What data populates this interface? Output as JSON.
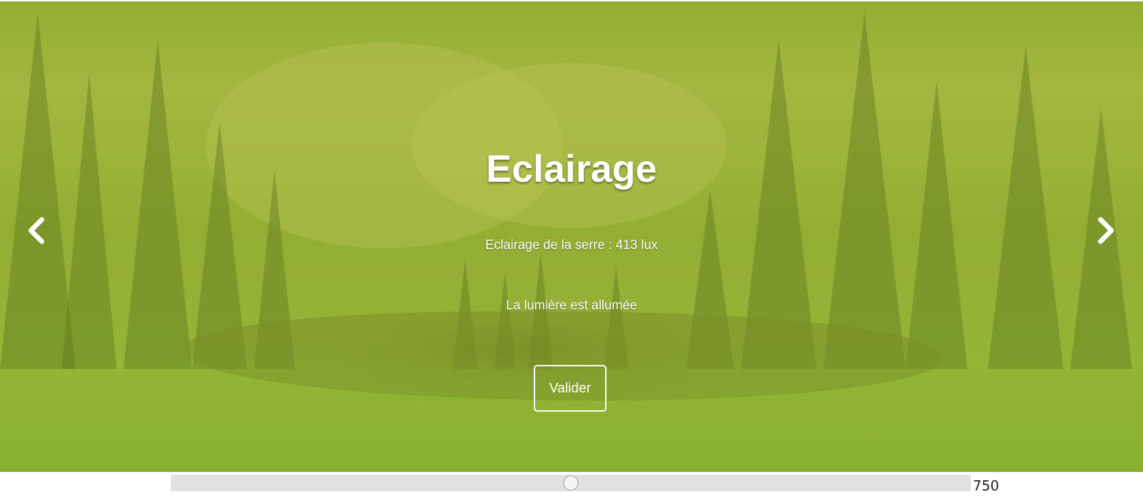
{
  "carousel": {
    "title": "Eclairage",
    "reading": "Eclairage de la serre : 413 lux",
    "status": "La lumière est allumée",
    "button_label": "Valider",
    "prev_icon": "chevron-left-icon",
    "next_icon": "chevron-right-icon",
    "overlay_color": "#a0be28"
  },
  "slider": {
    "value_label": "750",
    "value": 750,
    "min": 0,
    "max": 1500
  }
}
